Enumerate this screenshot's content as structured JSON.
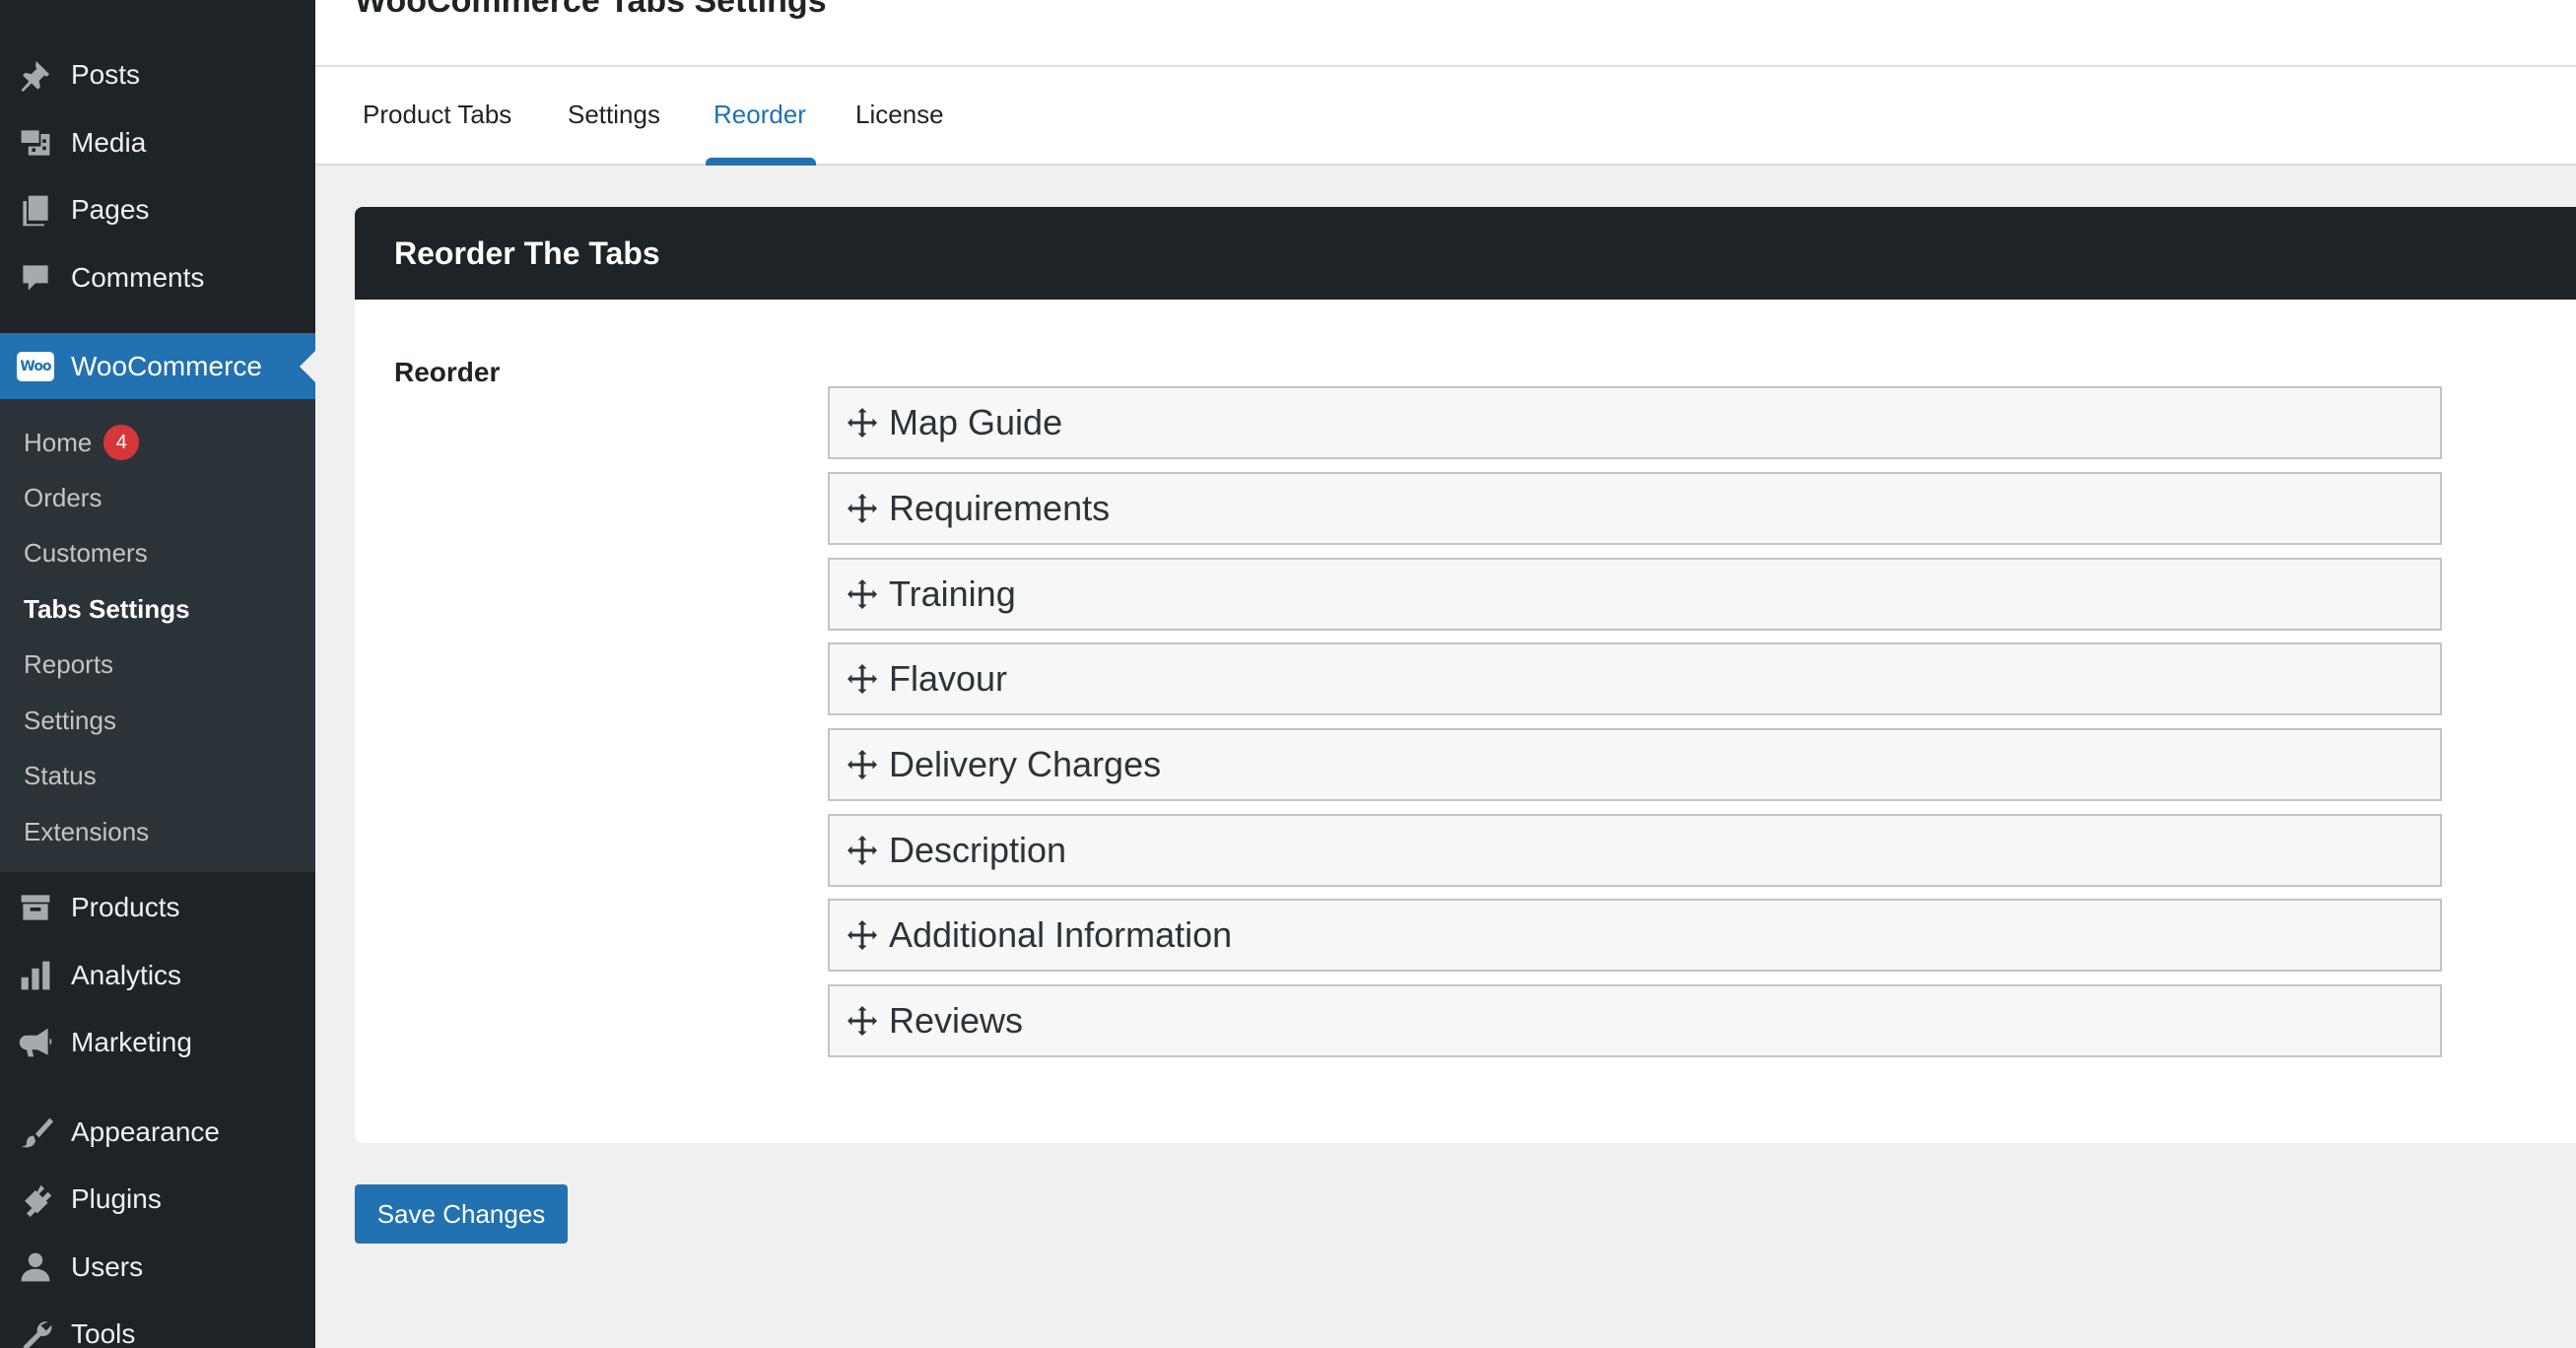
{
  "page": {
    "title": "WooCommerce Tabs Settings"
  },
  "sidebar": {
    "top_items": [
      {
        "label": "Posts",
        "icon": "pin-icon"
      },
      {
        "label": "Media",
        "icon": "media-icon"
      },
      {
        "label": "Pages",
        "icon": "pages-icon"
      },
      {
        "label": "Comments",
        "icon": "comment-icon"
      }
    ],
    "woocommerce": {
      "label": "WooCommerce",
      "logo_text": "Woo"
    },
    "submenu": [
      {
        "label": "Home",
        "badge": "4"
      },
      {
        "label": "Orders"
      },
      {
        "label": "Customers"
      },
      {
        "label": "Tabs Settings",
        "current": true
      },
      {
        "label": "Reports"
      },
      {
        "label": "Settings"
      },
      {
        "label": "Status"
      },
      {
        "label": "Extensions"
      }
    ],
    "bottom_items": [
      {
        "label": "Products",
        "icon": "archive-icon"
      },
      {
        "label": "Analytics",
        "icon": "bar-chart-icon"
      },
      {
        "label": "Marketing",
        "icon": "megaphone-icon"
      },
      {
        "label": "Appearance",
        "icon": "paintbrush-icon"
      },
      {
        "label": "Plugins",
        "icon": "plug-icon"
      },
      {
        "label": "Users",
        "icon": "user-icon"
      },
      {
        "label": "Tools",
        "icon": "wrench-icon"
      }
    ]
  },
  "tabs": [
    {
      "label": "Product Tabs"
    },
    {
      "label": "Settings"
    },
    {
      "label": "Reorder",
      "active": true
    },
    {
      "label": "License"
    }
  ],
  "panel": {
    "title": "Reorder The Tabs",
    "field_label": "Reorder",
    "items": [
      "Map Guide",
      "Requirements",
      "Training",
      "Flavour",
      "Delivery Charges",
      "Description",
      "Additional Information",
      "Reviews"
    ]
  },
  "actions": {
    "save_label": "Save Changes"
  },
  "colors": {
    "accent": "#2271b1",
    "sidebar": "#1d2327",
    "submenu": "#2c3338",
    "badge": "#d63638"
  }
}
